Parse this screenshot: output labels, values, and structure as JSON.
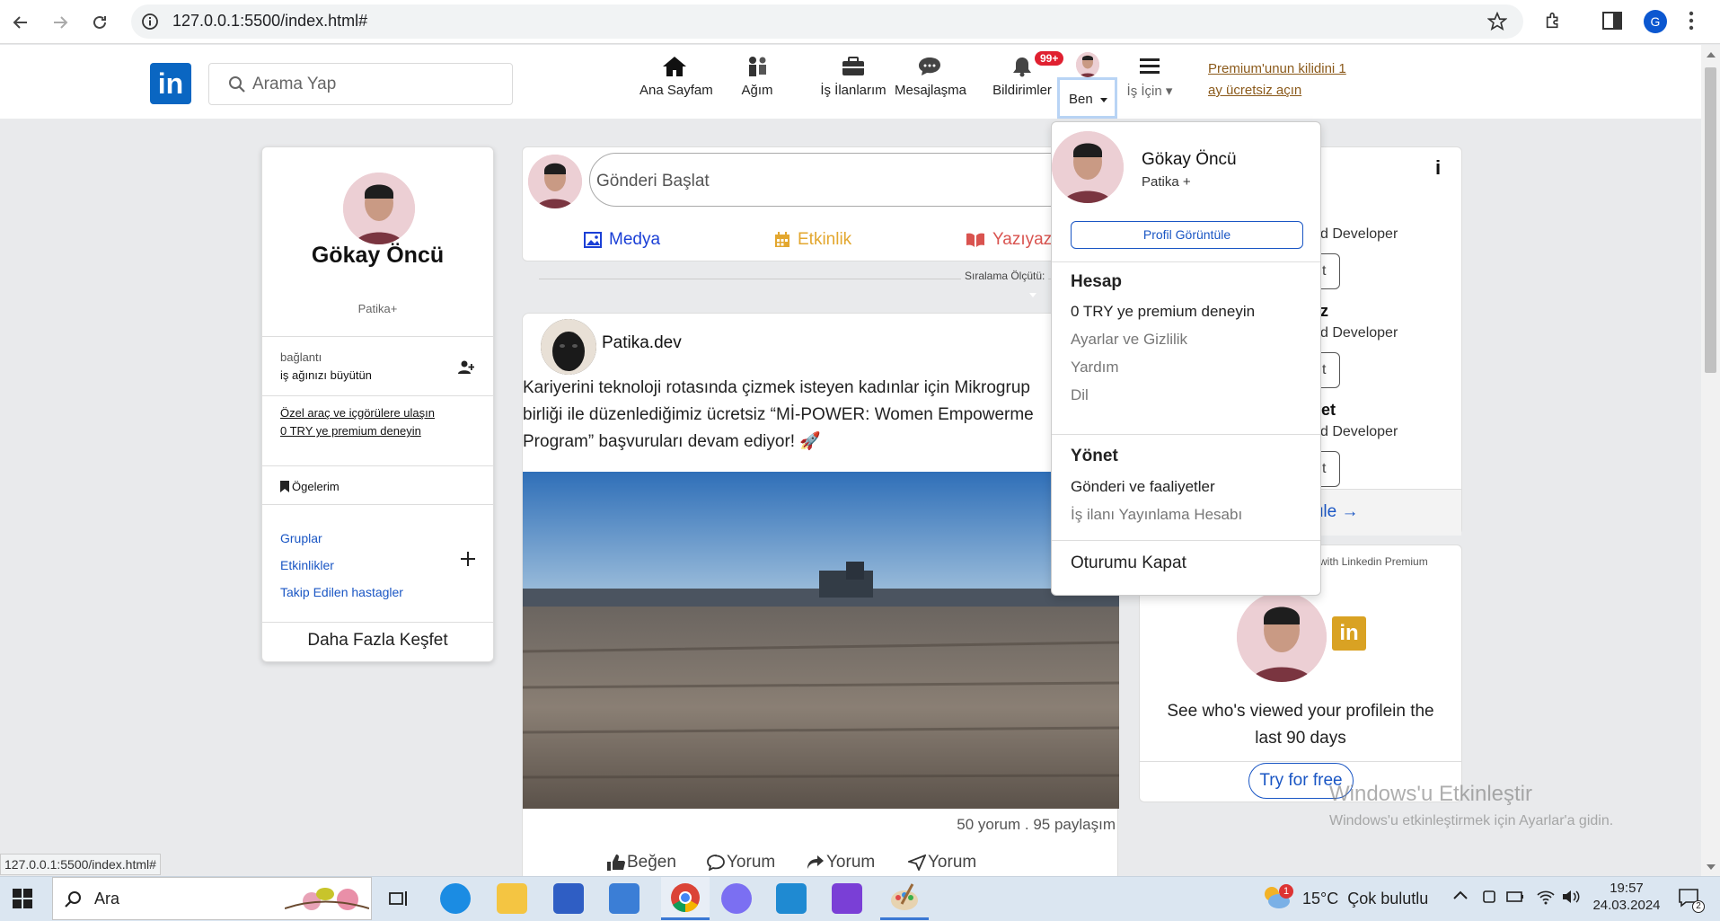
{
  "browser": {
    "url": "127.0.0.1:5500/index.html#",
    "status_url": "127.0.0.1:5500/index.html#",
    "profile_initial": "G"
  },
  "nav": {
    "search_placeholder": "Arama Yap",
    "items": [
      {
        "label": "Ana Sayfam",
        "icon": "home-icon"
      },
      {
        "label": "Ağım",
        "icon": "network-icon"
      },
      {
        "label": "İş İlanlarım",
        "icon": "briefcase-icon"
      },
      {
        "label": "Mesajlaşma",
        "icon": "chat-icon"
      },
      {
        "label": "Bildirimler",
        "icon": "bell-icon"
      }
    ],
    "notification_badge": "99+",
    "me_label": "Ben",
    "business_label": "İş İçin",
    "premium_line1": "Premium'unun kilidini 1",
    "premium_line2": "ay ücretsiz açın"
  },
  "profile_card": {
    "name": "Gökay Öncü",
    "subtitle": "Patika+",
    "connections_label": "bağlantı",
    "connections_cta": "iş ağınızı büyütün",
    "premium_link1": "Özel araç ve içgörülere ulaşın",
    "premium_link2": "0 TRY ye premium deneyin",
    "saved_items": "Ögelerim",
    "groups": "Gruplar",
    "events": "Etkinlikler",
    "hashtags": "Takip Edilen hastagler",
    "discover_more": "Daha Fazla Keşfet"
  },
  "composer": {
    "placeholder": "Gönderi Başlat",
    "media": "Medya",
    "event": "Etkinlik",
    "article": "Yazıyaz",
    "sort_label": "Sıralama Ölçütü:"
  },
  "post": {
    "author": "Patika.dev",
    "text_line1": "Kariyerini teknoloji rotasında çizmek isteyen kadınlar için Mikrogrup",
    "text_line2": "birliği ile düzenlediğimiz ücretsiz “Mİ-POWER: Women Empowerme",
    "text_line3": "Program” başvuruları devam ediyor! 🚀",
    "stats": "50 yorum . 95 paylaşım",
    "actions": [
      "Beğen",
      "Yorum",
      "Yorum",
      "Yorum"
    ]
  },
  "right_card": {
    "role1": "d Developer",
    "role2": "d Developer",
    "role3": "d Developer",
    "name_frag2": "z",
    "name_frag3": "ffet",
    "btn_frag": "t",
    "view_all": "ntüle →",
    "info_icon": "i"
  },
  "promo": {
    "header": "with Linkedin Premium",
    "text_line1": "See who's viewed your profilein the",
    "text_line2": "last 90 days",
    "cta": "Try for free"
  },
  "dropdown": {
    "name": "Gökay Öncü",
    "subtitle": "Patika +",
    "view_profile": "Profil Görüntüle",
    "account_heading": "Hesap",
    "account_items": [
      "0 TRY ye premium deneyin",
      "Ayarlar ve Gizlilik",
      "Yardım",
      "Dil"
    ],
    "manage_heading": "Yönet",
    "manage_items": [
      "Gönderi ve faaliyetler",
      "İş ilanı Yayınlama Hesabı"
    ],
    "sign_out": "Oturumu Kapat"
  },
  "windows": {
    "watermark_title": "Windows'u Etkinleştir",
    "watermark_sub": "Windows'u etkinleştirmek için Ayarlar'a gidin.",
    "search_placeholder": "Ara",
    "weather": "15°C  Çok bulutlu",
    "weather_badge": "1",
    "time": "19:57",
    "date": "24.03.2024",
    "notif_count": "2"
  },
  "colors": {
    "brand": "#0a66c2",
    "badge": "#e02030",
    "premium_link": "#8b5a1b",
    "media": "#1a3fd6",
    "event": "#e3a72f",
    "article": "#d9534f"
  }
}
